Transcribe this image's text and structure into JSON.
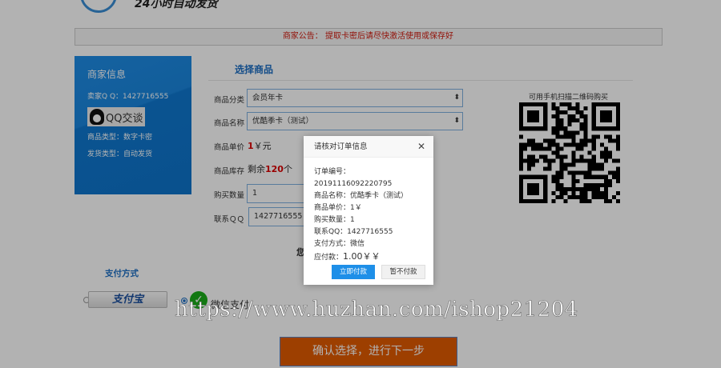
{
  "header": {
    "logo_text": "24小时自动发货"
  },
  "notice": {
    "label": "商家公告：",
    "text": "提取卡密后请尽快激活使用或保存好"
  },
  "merchant": {
    "title": "商家信息",
    "qq_label": "卖家Q Q：",
    "qq": "1427716555",
    "qq_chat": "QQ交谈",
    "type_label": "商品类型：",
    "type": "数字卡密",
    "delivery_label": "发货类型：",
    "delivery": "自动发货"
  },
  "form": {
    "section_title": "选择商品",
    "category_label": "商品分类",
    "category_value": "会员年卡",
    "name_label": "商品名称",
    "name_value": "优酷季卡（测试）",
    "price_label": "商品单价",
    "price_num": "1",
    "price_unit": "￥元",
    "stock_label": "商品库存",
    "stock_prefix": "剩余",
    "stock_num": "120",
    "stock_suffix": "个",
    "qty_label": "购买数量",
    "qty_value": "1",
    "qq_label": "联系ＱＱ",
    "qq_value": "1427716555",
    "hidden_note": "您"
  },
  "qr": {
    "title": "可用手机扫描二维码购买"
  },
  "payment": {
    "title": "支付方式",
    "alipay": "支付宝",
    "wechat": "微信支付",
    "selected": "wechat"
  },
  "confirm_button": "确认选择，进行下一步",
  "watermark": "https://www.huzhan.com/ishop21204",
  "modal": {
    "title": "请核对订单信息",
    "lines": [
      "订单编号：20191116092220795",
      "商品名称：优酷季卡（测试）",
      "商品单价：1￥",
      "购买数量：1",
      "联系QQ：1427716555",
      "支付方式：微信"
    ],
    "amount_label": "应付款：",
    "amount": "1.00￥￥",
    "pay_button": "立即付款",
    "cancel_button": "暂不付款"
  },
  "colors": {
    "accent": "#1d6fc4",
    "notice": "#d2190c",
    "confirm": "#e15b00",
    "pay_button": "#1e8fe8"
  }
}
